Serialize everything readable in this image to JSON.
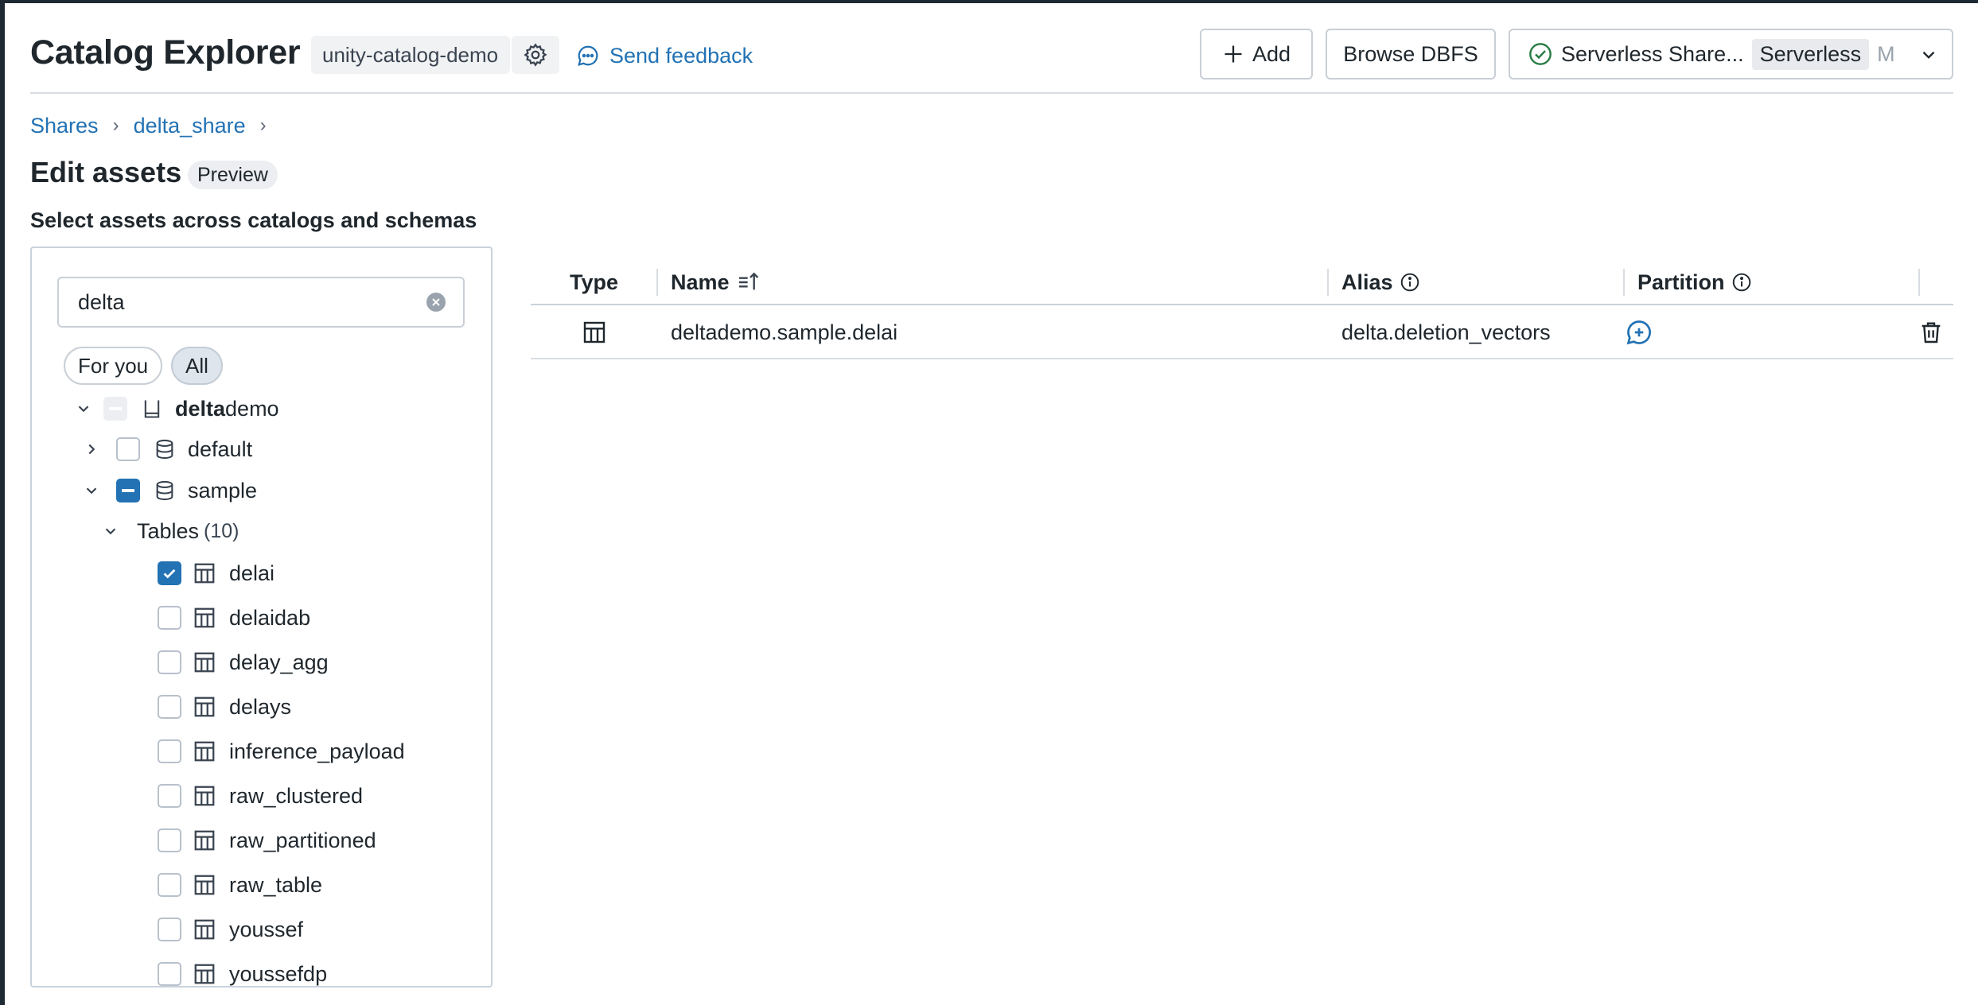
{
  "header": {
    "title": "Catalog Explorer",
    "workspace": "unity-catalog-demo",
    "feedback_label": "Send feedback",
    "add_label": "Add",
    "dbfs_label": "Browse DBFS",
    "compute_name": "Serverless Share...",
    "compute_tag": "Serverless",
    "compute_extra": "M"
  },
  "breadcrumb": {
    "shares": "Shares",
    "share": "delta_share"
  },
  "page": {
    "title": "Edit assets",
    "badge": "Preview",
    "subtitle": "Select assets across catalogs and schemas"
  },
  "search": {
    "value": "delta"
  },
  "filters": {
    "for_you": "For you",
    "all": "All"
  },
  "tree": {
    "catalog": {
      "match": "delta",
      "rest": "demo"
    },
    "schemas": {
      "default": "default",
      "sample": "sample"
    },
    "tables_group": {
      "label": "Tables",
      "count": "(10)"
    },
    "tables": [
      {
        "name": "delai",
        "checked": true
      },
      {
        "name": "delaidab",
        "checked": false
      },
      {
        "name": "delay_agg",
        "checked": false
      },
      {
        "name": "delays",
        "checked": false
      },
      {
        "name": "inference_payload",
        "checked": false
      },
      {
        "name": "raw_clustered",
        "checked": false
      },
      {
        "name": "raw_partitioned",
        "checked": false
      },
      {
        "name": "raw_table",
        "checked": false
      },
      {
        "name": "youssef",
        "checked": false
      },
      {
        "name": "youssefdp",
        "checked": false
      }
    ]
  },
  "table": {
    "columns": {
      "type": "Type",
      "name": "Name",
      "alias": "Alias",
      "partition": "Partition"
    },
    "rows": [
      {
        "name": "deltademo.sample.delai",
        "alias": "delta.deletion_vectors"
      }
    ]
  },
  "colors": {
    "accent": "#2272b4",
    "text": "#1f272d",
    "border": "#c9cfd6",
    "success": "#277c43"
  }
}
